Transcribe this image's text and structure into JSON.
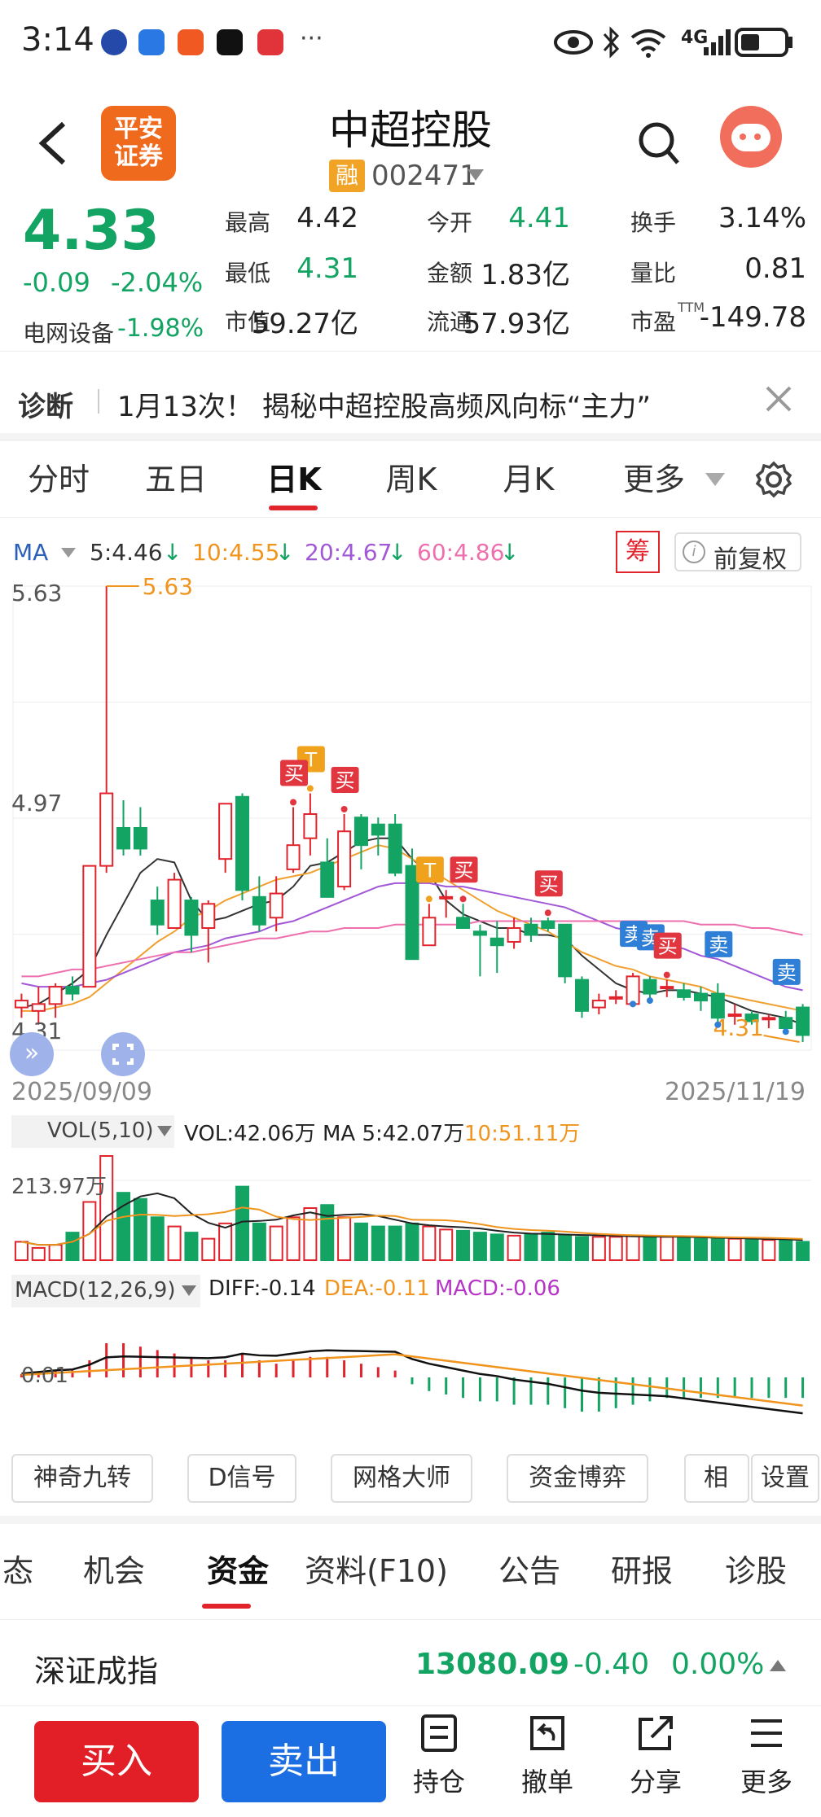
{
  "status": {
    "time": "3:14",
    "dots": "···",
    "net": "4G",
    "app_icons": [
      "tiktok-icon",
      "mail-icon",
      "pingan-icon",
      "bilibili-icon",
      "browser-icon"
    ]
  },
  "header": {
    "back": "back",
    "logo_line1": "平安",
    "logo_line2": "证券",
    "title": "中超控股",
    "badge": "融",
    "code": "002471"
  },
  "quote": {
    "price": "4.33",
    "change": "-0.09",
    "change_pct": "-2.04%",
    "sector_label": "电网设备",
    "sector_pct": "-1.98%",
    "cells": [
      {
        "label": "最高",
        "value": "4.42",
        "color": "#222"
      },
      {
        "label": "今开",
        "value": "4.41",
        "color": "#13a463"
      },
      {
        "label": "换手",
        "value": "3.14%",
        "color": "#222"
      },
      {
        "label": "最低",
        "value": "4.31",
        "color": "#13a463"
      },
      {
        "label": "金额",
        "value": "1.83亿",
        "color": "#222"
      },
      {
        "label": "量比",
        "value": "0.81",
        "color": "#222"
      },
      {
        "label": "市值",
        "value": "59.27亿",
        "color": "#222"
      },
      {
        "label": "流通",
        "value": "57.93亿",
        "color": "#222"
      },
      {
        "label": "市盈",
        "value": "-149.78",
        "color": "#222"
      }
    ],
    "pe_sup": "TTM"
  },
  "diagnosis": {
    "label": "诊断",
    "text": "1月13次！ 揭秘中超控股高频风向标“主力”"
  },
  "periods": [
    "分时",
    "五日",
    "日K",
    "周K",
    "月K",
    "更多"
  ],
  "active_period": "日K",
  "ma": {
    "label": "MA",
    "ma5": "5:4.46",
    "ma10": "10:4.55",
    "ma20": "20:4.67",
    "ma60": "60:4.86",
    "chip": "筹",
    "adjust": "前复权"
  },
  "chart_data": {
    "type": "candlestick",
    "date_start": "2025/09/09",
    "date_end": "2025/11/19",
    "y_ticks": [
      "5.63",
      "4.97",
      "4.31"
    ],
    "high_label": "5.63",
    "low_label": "4.31",
    "ylim": [
      4.31,
      5.63
    ],
    "candles": [
      [
        4.41,
        4.43,
        4.38,
        4.45
      ],
      [
        4.4,
        4.42,
        4.36,
        4.47
      ],
      [
        4.42,
        4.47,
        4.38,
        4.48
      ],
      [
        4.47,
        4.45,
        4.43,
        4.5
      ],
      [
        4.47,
        4.82,
        4.47,
        4.82
      ],
      [
        4.82,
        5.03,
        4.8,
        5.63
      ],
      [
        4.93,
        4.87,
        4.85,
        5.01
      ],
      [
        4.93,
        4.87,
        4.85,
        4.99
      ],
      [
        4.72,
        4.65,
        4.62,
        4.76
      ],
      [
        4.64,
        4.78,
        4.64,
        4.8
      ],
      [
        4.72,
        4.62,
        4.57,
        4.73
      ],
      [
        4.64,
        4.71,
        4.54,
        4.72
      ],
      [
        4.84,
        5.0,
        4.8,
        5.0
      ],
      [
        5.02,
        4.75,
        4.72,
        5.03
      ],
      [
        4.73,
        4.65,
        4.63,
        4.79
      ],
      [
        4.67,
        4.74,
        4.63,
        4.79
      ],
      [
        4.81,
        4.88,
        4.8,
        4.99
      ],
      [
        4.9,
        4.97,
        4.85,
        5.03
      ],
      [
        4.83,
        4.73,
        4.73,
        4.9
      ],
      [
        4.76,
        4.92,
        4.75,
        4.97
      ],
      [
        4.96,
        4.88,
        4.81,
        4.97
      ],
      [
        4.94,
        4.91,
        4.85,
        4.96
      ],
      [
        4.94,
        4.8,
        4.79,
        4.97
      ],
      [
        4.82,
        4.55,
        4.55,
        4.87
      ],
      [
        4.59,
        4.67,
        4.59,
        4.71
      ],
      [
        4.73,
        4.73,
        4.67,
        4.75
      ],
      [
        4.67,
        4.64,
        4.64,
        4.71
      ],
      [
        4.63,
        4.62,
        4.5,
        4.65
      ],
      [
        4.61,
        4.59,
        4.51,
        4.66
      ],
      [
        4.6,
        4.64,
        4.58,
        4.67
      ],
      [
        4.65,
        4.62,
        4.6,
        4.67
      ],
      [
        4.66,
        4.64,
        4.63,
        4.67
      ],
      [
        4.65,
        4.5,
        4.48,
        4.65
      ],
      [
        4.49,
        4.4,
        4.38,
        4.5
      ],
      [
        4.41,
        4.43,
        4.39,
        4.45
      ],
      [
        4.44,
        4.44,
        4.42,
        4.46
      ],
      [
        4.42,
        4.5,
        4.42,
        4.51
      ],
      [
        4.49,
        4.45,
        4.43,
        4.5
      ],
      [
        4.47,
        4.47,
        4.44,
        4.49
      ],
      [
        4.46,
        4.44,
        4.43,
        4.48
      ],
      [
        4.45,
        4.43,
        4.4,
        4.47
      ],
      [
        4.45,
        4.38,
        4.36,
        4.48
      ],
      [
        4.39,
        4.39,
        4.36,
        4.42
      ],
      [
        4.39,
        4.37,
        4.36,
        4.4
      ],
      [
        4.38,
        4.38,
        4.35,
        4.39
      ],
      [
        4.38,
        4.35,
        4.34,
        4.4
      ],
      [
        4.41,
        4.33,
        4.31,
        4.42
      ]
    ],
    "signals": [
      {
        "idx": 17,
        "kind": "T",
        "text": "T",
        "color": "#f0a21d"
      },
      {
        "idx": 19,
        "kind": "buy",
        "text": "买",
        "color": "#e1353f"
      },
      {
        "idx": 16,
        "kind": "buy",
        "text": "买",
        "color": "#e1353f"
      },
      {
        "idx": 24,
        "kind": "T",
        "text": "T",
        "color": "#f0a21d"
      },
      {
        "idx": 26,
        "kind": "buy",
        "text": "买",
        "color": "#e1353f"
      },
      {
        "idx": 31,
        "kind": "buy",
        "text": "买",
        "color": "#e1353f"
      },
      {
        "idx": 36,
        "kind": "sell",
        "text": "卖",
        "color": "#2f7fd6"
      },
      {
        "idx": 37,
        "kind": "sell",
        "text": "卖",
        "color": "#2f7fd6"
      },
      {
        "idx": 38,
        "kind": "buy",
        "text": "买",
        "color": "#e1353f"
      },
      {
        "idx": 41,
        "kind": "sell",
        "text": "卖",
        "color": "#2f7fd6"
      },
      {
        "idx": 45,
        "kind": "sell",
        "text": "卖",
        "color": "#2f7fd6"
      }
    ],
    "ma_lines": {
      "ma5": [
        4.41,
        4.42,
        4.45,
        4.48,
        4.52,
        4.62,
        4.71,
        4.8,
        4.84,
        4.83,
        4.72,
        4.66,
        4.67,
        4.69,
        4.71,
        4.72,
        4.76,
        4.82,
        4.83,
        4.86,
        4.89,
        4.9,
        4.9,
        4.84,
        4.8,
        4.72,
        4.68,
        4.66,
        4.64,
        4.64,
        4.62,
        4.62,
        4.61,
        4.56,
        4.52,
        4.48,
        4.46,
        4.45,
        4.46,
        4.46,
        4.45,
        4.44,
        4.42,
        4.4,
        4.39,
        4.38,
        4.36
      ],
      "ma10": [
        4.4,
        4.4,
        4.41,
        4.42,
        4.44,
        4.48,
        4.52,
        4.56,
        4.6,
        4.63,
        4.67,
        4.69,
        4.72,
        4.74,
        4.76,
        4.78,
        4.79,
        4.8,
        4.82,
        4.84,
        4.86,
        4.88,
        4.87,
        4.84,
        4.81,
        4.78,
        4.75,
        4.72,
        4.69,
        4.67,
        4.65,
        4.63,
        4.6,
        4.57,
        4.55,
        4.53,
        4.52,
        4.5,
        4.49,
        4.48,
        4.47,
        4.45,
        4.44,
        4.43,
        4.42,
        4.41,
        4.4
      ],
      "ma20": [
        4.48,
        4.47,
        4.47,
        4.47,
        4.48,
        4.49,
        4.51,
        4.53,
        4.55,
        4.57,
        4.58,
        4.59,
        4.61,
        4.62,
        4.63,
        4.65,
        4.66,
        4.68,
        4.7,
        4.72,
        4.74,
        4.76,
        4.77,
        4.77,
        4.77,
        4.76,
        4.76,
        4.75,
        4.74,
        4.73,
        4.72,
        4.71,
        4.7,
        4.68,
        4.66,
        4.64,
        4.63,
        4.61,
        4.59,
        4.58,
        4.56,
        4.55,
        4.53,
        4.51,
        4.49,
        4.47,
        4.46
      ],
      "ma60": [
        4.5,
        4.5,
        4.51,
        4.52,
        4.52,
        4.53,
        4.54,
        4.55,
        4.56,
        4.57,
        4.57,
        4.58,
        4.59,
        4.6,
        4.61,
        4.61,
        4.62,
        4.63,
        4.63,
        4.64,
        4.64,
        4.64,
        4.65,
        4.65,
        4.65,
        4.65,
        4.65,
        4.66,
        4.66,
        4.66,
        4.66,
        4.66,
        4.66,
        4.66,
        4.66,
        4.66,
        4.66,
        4.66,
        4.66,
        4.66,
        4.65,
        4.65,
        4.65,
        4.64,
        4.64,
        4.63,
        4.62
      ]
    },
    "volume": {
      "label": "VOL(5,10)",
      "vol": "VOL:42.06万",
      "ma5": "MA 5:42.07万",
      "ma10": "10:51.11万",
      "tick": "213.97万",
      "bars": [
        30,
        20,
        25,
        45,
        95,
        170,
        110,
        100,
        70,
        55,
        45,
        35,
        60,
        120,
        60,
        55,
        70,
        85,
        90,
        70,
        60,
        55,
        55,
        60,
        55,
        50,
        48,
        45,
        42,
        40,
        42,
        45,
        40,
        38,
        38,
        38,
        40,
        38,
        38,
        36,
        35,
        36,
        35,
        34,
        33,
        32,
        30
      ]
    },
    "macd": {
      "label": "MACD(12,26,9)",
      "diff": "DIFF:-0.14",
      "dea": "DEA:-0.11",
      "macd": "MACD:-0.06",
      "tick": "0.01",
      "hist": [
        0.01,
        0.015,
        0.02,
        0.02,
        0.05,
        0.1,
        0.1,
        0.09,
        0.08,
        0.07,
        0.06,
        0.05,
        0.05,
        0.07,
        0.05,
        0.04,
        0.05,
        0.06,
        0.06,
        0.05,
        0.04,
        0.03,
        0.02,
        -0.02,
        -0.04,
        -0.05,
        -0.06,
        -0.07,
        -0.07,
        -0.08,
        -0.08,
        -0.08,
        -0.09,
        -0.1,
        -0.1,
        -0.09,
        -0.08,
        -0.07,
        -0.06,
        -0.06,
        -0.06,
        -0.06,
        -0.06,
        -0.06,
        -0.06,
        -0.06,
        -0.06
      ]
    }
  },
  "indicator_tools": [
    "神奇九转",
    "D信号",
    "网格大师",
    "资金博弈",
    "相似",
    "设置"
  ],
  "fund_tabs": [
    "态",
    "机会",
    "资金",
    "资料(F10)",
    "公告",
    "研报",
    "诊股"
  ],
  "active_fund_tab": "资金",
  "index": {
    "name": "深证成指",
    "value": "13080.09",
    "change": "-0.40",
    "pct": "0.00%"
  },
  "bottom": {
    "buy": "买入",
    "sell": "卖出",
    "hold": "持仓",
    "cancel": "撤单",
    "share": "分享",
    "more": "更多"
  }
}
